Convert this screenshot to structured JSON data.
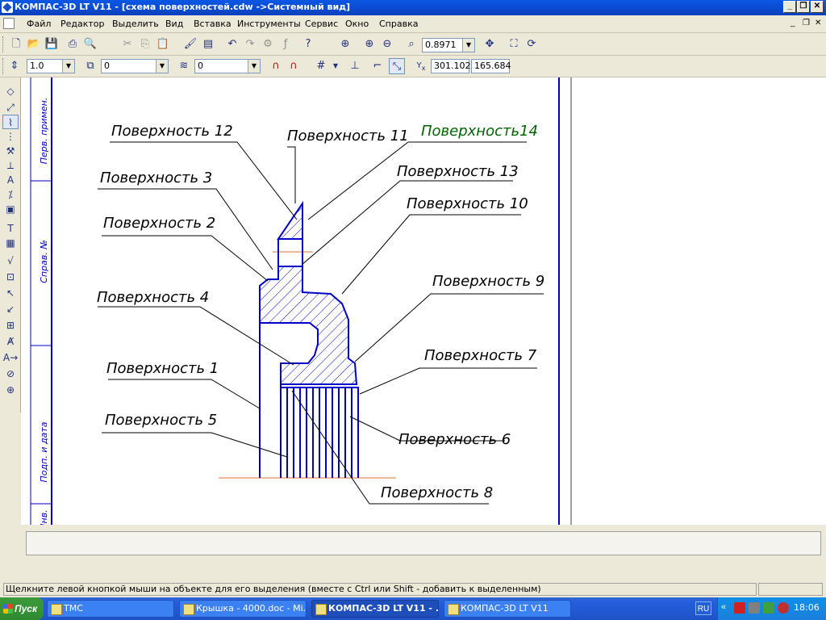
{
  "window": {
    "title": "КОМПАС-3D LT V11 - [схема поверхностей.cdw ->Системный вид]"
  },
  "menu": {
    "items": [
      "Файл",
      "Редактор",
      "Выделить",
      "Вид",
      "Вставка",
      "Инструменты",
      "Сервис",
      "Окно",
      "Справка"
    ]
  },
  "toolbar1": {
    "zoom_value": "0.8971"
  },
  "toolbar2": {
    "line_scale": "1.0",
    "layer": "0",
    "style": "0",
    "coord_x": "301.102",
    "coord_y": "165.684"
  },
  "drawing": {
    "frame_labels": [
      "Перв. примен.",
      "Справ. №",
      "Подп. и дата",
      "Инв."
    ],
    "labels": [
      {
        "id": "s12",
        "text": "Поверхность 12"
      },
      {
        "id": "s11",
        "text": "Поверхность 11"
      },
      {
        "id": "s14",
        "text": "Поверхность14"
      },
      {
        "id": "s3",
        "text": "Поверхность 3"
      },
      {
        "id": "s13",
        "text": "Поверхность 13"
      },
      {
        "id": "s2",
        "text": "Поверхность 2"
      },
      {
        "id": "s10",
        "text": "Поверхность 10"
      },
      {
        "id": "s9",
        "text": "Поверхность 9"
      },
      {
        "id": "s4",
        "text": "Поверхность 4"
      },
      {
        "id": "s7",
        "text": "Поверхность 7"
      },
      {
        "id": "s1",
        "text": "Поверхность 1"
      },
      {
        "id": "s5",
        "text": "Поверхность 5"
      },
      {
        "id": "s6",
        "text": "Поверхность 6"
      },
      {
        "id": "s8",
        "text": "Поверхность 8"
      }
    ],
    "colors": {
      "frame": "#0000c8",
      "label": "#000000",
      "highlight_label": "#006400",
      "axis": "#e07020"
    }
  },
  "statusbar": {
    "hint": "Щелкните левой кнопкой мыши на объекте для его выделения (вместе с Ctrl или Shift - добавить к выделенным)"
  },
  "taskbar": {
    "start_label": "Пуск",
    "tasks": [
      "ТМС",
      "Крышка - 4000.doc - Mi...",
      "КОМПАС-3D LT V11 - ...",
      "КОМПАС-3D LT V11"
    ],
    "language": "RU",
    "clock": "18:06"
  }
}
